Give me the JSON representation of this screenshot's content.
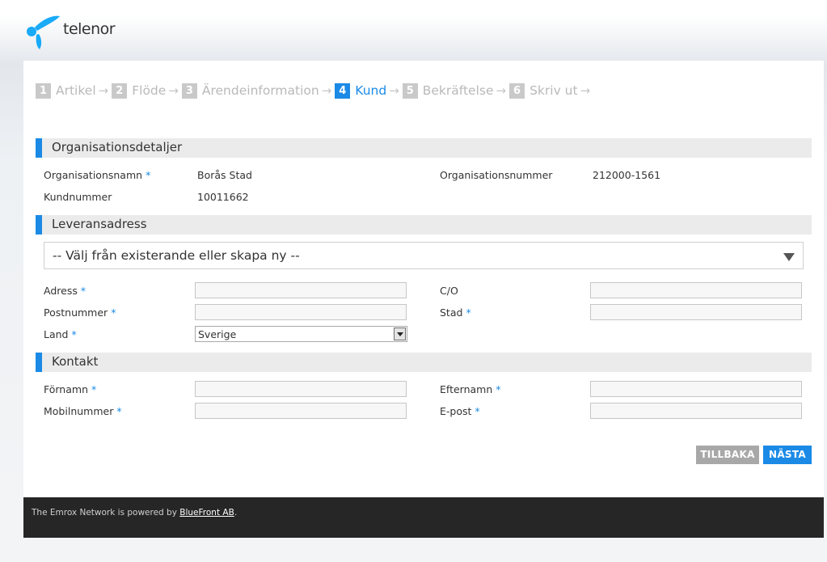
{
  "brand": {
    "name": "telenor",
    "logo_icon": "telenor-propeller-logo",
    "accent_color": "#1a8ae6"
  },
  "steps": [
    {
      "num": "1",
      "label": "Artikel",
      "active": false
    },
    {
      "num": "2",
      "label": "Flöde",
      "active": false
    },
    {
      "num": "3",
      "label": "Ärendeinformation",
      "active": false
    },
    {
      "num": "4",
      "label": "Kund",
      "active": true
    },
    {
      "num": "5",
      "label": "Bekräftelse",
      "active": false
    },
    {
      "num": "6",
      "label": "Skriv ut",
      "active": false
    }
  ],
  "sections": {
    "org": {
      "title": "Organisationsdetaljer",
      "org_name_label": "Organisationsnamn",
      "org_name_value": "Borås Stad",
      "org_number_label": "Organisationsnummer",
      "org_number_value": "212000-1561",
      "customer_number_label": "Kundnummer",
      "customer_number_value": "10011662"
    },
    "delivery": {
      "title": "Leveransadress",
      "address_select": "-- Välj från existerande eller skapa ny --",
      "address_label": "Adress",
      "address_value": "",
      "co_label": "C/O",
      "co_value": "",
      "postal_label": "Postnummer",
      "postal_value": "",
      "city_label": "Stad",
      "city_value": "",
      "country_label": "Land",
      "country_value": "Sverige"
    },
    "contact": {
      "title": "Kontakt",
      "firstname_label": "Förnamn",
      "firstname_value": "",
      "lastname_label": "Efternamn",
      "lastname_value": "",
      "mobile_label": "Mobilnummer",
      "mobile_value": "",
      "email_label": "E-post",
      "email_value": ""
    }
  },
  "required_mark": "*",
  "buttons": {
    "back": "TILLBAKA",
    "next": "NÄSTA"
  },
  "footer": {
    "text": "The Emrox Network is powered by ",
    "link": "BlueFront AB",
    "end": "."
  }
}
